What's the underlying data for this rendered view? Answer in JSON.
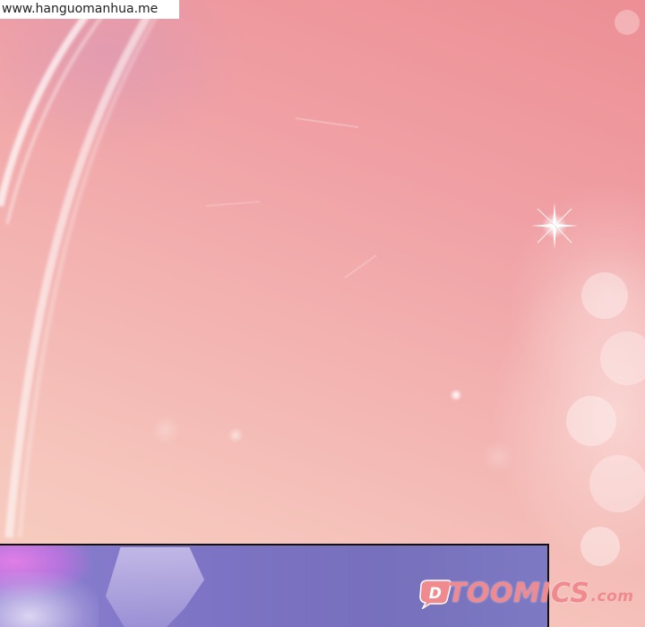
{
  "watermark": {
    "text": "www.hanguomanhua.me"
  },
  "logo": {
    "text": "TOOMICS",
    "tld": ".com",
    "color": "#ef8a8f"
  },
  "palette": {
    "sky_top": "#ec8f95",
    "sky_bottom": "#f8d0c1",
    "panel_purple": "#7c73c4"
  },
  "icons": [
    "sparkle-icon",
    "toomics-bubble-icon"
  ]
}
